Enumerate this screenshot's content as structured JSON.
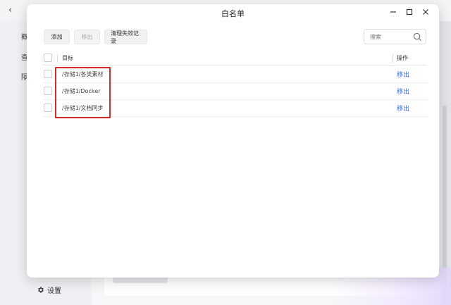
{
  "background": {
    "sidebar_items": [
      "概",
      "查",
      "隔"
    ],
    "settings_label": "设置"
  },
  "dialog": {
    "title": "白名单",
    "toolbar": {
      "add_label": "添加",
      "remove_label": "移出",
      "clear_label": "清理失效记录"
    },
    "search": {
      "placeholder": "搜索"
    },
    "table": {
      "headers": {
        "target": "目标",
        "action": "操作"
      },
      "rows": [
        {
          "path": "/存储1/各类素材",
          "action": "移出"
        },
        {
          "path": "/存储1/Docker",
          "action": "移出"
        },
        {
          "path": "/存储1/文档同步",
          "action": "移出"
        }
      ]
    }
  },
  "colors": {
    "link": "#3a6ff0",
    "highlight": "#d32a2a"
  }
}
